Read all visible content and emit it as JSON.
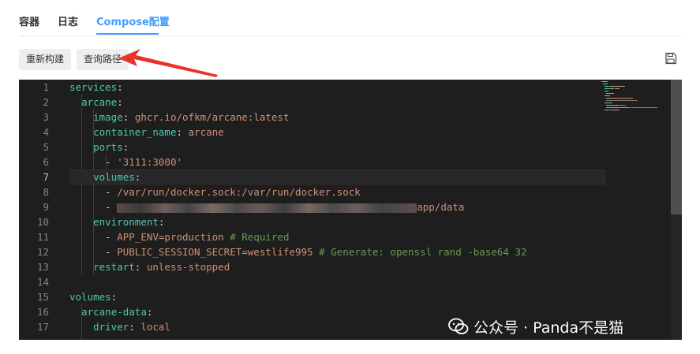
{
  "tabs": [
    {
      "label": "容器",
      "active": false
    },
    {
      "label": "日志",
      "active": false
    },
    {
      "label": "Compose配置",
      "active": true
    }
  ],
  "toolbar": {
    "restart_build_label": "重新构建",
    "query_path_label": "查询路径",
    "save_icon": "save-icon"
  },
  "editor": {
    "line_numbers": [
      "1",
      "2",
      "3",
      "4",
      "5",
      "6",
      "7",
      "8",
      "9",
      "10",
      "11",
      "12",
      "13",
      "14",
      "15",
      "16",
      "17"
    ],
    "current_line": 7,
    "lines": [
      {
        "k": "services",
        "p": ":"
      },
      {
        "k": "arcane",
        "p": ":"
      },
      {
        "k": "image",
        "p": ": ",
        "v": "ghcr.io/ofkm/arcane:latest"
      },
      {
        "k": "container_name",
        "p": ": ",
        "v": "arcane"
      },
      {
        "k": "ports",
        "p": ":"
      },
      {
        "dash": "- ",
        "v": "'3111:3000'"
      },
      {
        "k": "volumes",
        "p": ":"
      },
      {
        "dash": "- ",
        "v": "/var/run/docker.sock:/var/run/docker.sock"
      },
      {
        "dash": "- ",
        "v": "app/data"
      },
      {
        "k": "environment",
        "p": ":"
      },
      {
        "dash": "- ",
        "v": "APP_ENV=production",
        "c": "# Required"
      },
      {
        "dash": "- ",
        "v": "PUBLIC_SESSION_SECRET=westlife995",
        "c": "# Generate: openssl rand -base64 32"
      },
      {
        "k": "restart",
        "p": ": ",
        "v": "unless-stopped"
      },
      {},
      {
        "k": "volumes",
        "p": ":"
      },
      {
        "k": "arcane-data",
        "p": ":"
      },
      {
        "k": "driver",
        "p": ": ",
        "v": "local"
      }
    ]
  },
  "watermark": {
    "text": "公众号 · Panda不是猫"
  },
  "colors": {
    "accent": "#409eff",
    "editor_bg": "#1e1e1e",
    "key": "#4ec9b0",
    "value": "#ce9178",
    "comment": "#6a9955",
    "arrow": "#e8332a"
  }
}
